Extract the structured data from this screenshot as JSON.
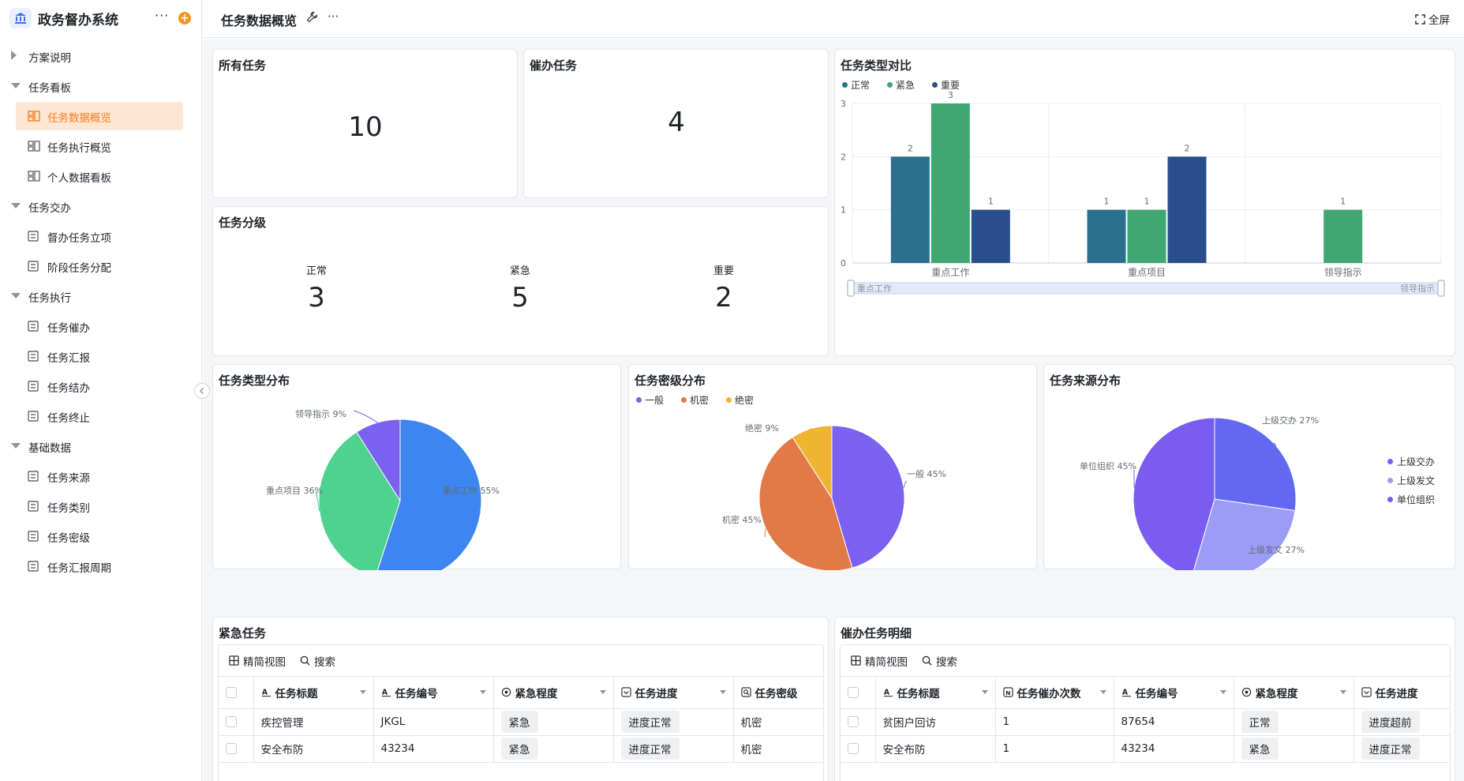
{
  "sidebar": {
    "app_title": "政务督办系统",
    "items": [
      {
        "label": "方案说明"
      },
      {
        "label": "任务看板"
      },
      {
        "label": "任务数据概览"
      },
      {
        "label": "任务执行概览"
      },
      {
        "label": "个人数据看板"
      },
      {
        "label": "任务交办"
      },
      {
        "label": "督办任务立项"
      },
      {
        "label": "阶段任务分配"
      },
      {
        "label": "任务执行"
      },
      {
        "label": "任务催办"
      },
      {
        "label": "任务汇报"
      },
      {
        "label": "任务结办"
      },
      {
        "label": "任务终止"
      },
      {
        "label": "基础数据"
      },
      {
        "label": "任务来源"
      },
      {
        "label": "任务类别"
      },
      {
        "label": "任务密级"
      },
      {
        "label": "任务汇报周期"
      }
    ]
  },
  "topbar": {
    "title": "任务数据概览",
    "fullscreen_label": "全屏"
  },
  "cards": {
    "all_tasks": {
      "title": "所有任务",
      "value": "10"
    },
    "urge_tasks": {
      "title": "催办任务",
      "value": "4"
    },
    "grading": {
      "title": "任务分级",
      "items": [
        {
          "label": "正常",
          "value": "3"
        },
        {
          "label": "紧急",
          "value": "5"
        },
        {
          "label": "重要",
          "value": "2"
        }
      ]
    }
  },
  "chart_data": [
    {
      "type": "bar",
      "title": "任务类型对比",
      "categories": [
        "重点工作",
        "重点项目",
        "领导指示"
      ],
      "series": [
        {
          "name": "正常",
          "color": "#2b6f8e",
          "values": [
            2,
            1,
            null
          ]
        },
        {
          "name": "紧急",
          "color": "#40a672",
          "values": [
            3,
            1,
            1
          ]
        },
        {
          "name": "重要",
          "color": "#2a4e8c",
          "values": [
            1,
            2,
            null
          ]
        }
      ],
      "yticks": [
        "0",
        "1",
        "2",
        "3"
      ],
      "ylim": [
        0,
        3
      ],
      "zoom_start_label": "重点工作",
      "zoom_end_label": "领导指示",
      "legend": "top-left"
    },
    {
      "type": "pie",
      "title": "任务类型分布",
      "slices": [
        {
          "label": "重点工作 55%",
          "value": 55,
          "color": "#3d86f2"
        },
        {
          "label": "重点项目 36%",
          "value": 36,
          "color": "#4fd18f"
        },
        {
          "label": "领导指示 9%",
          "value": 9,
          "color": "#7b61f0"
        }
      ]
    },
    {
      "type": "pie",
      "title": "任务密级分布",
      "legend_items": [
        {
          "name": "一般",
          "color": "#7b61f0"
        },
        {
          "name": "机密",
          "color": "#e27a48"
        },
        {
          "name": "绝密",
          "color": "#efb432"
        }
      ],
      "slices": [
        {
          "label": "一般 45%",
          "value": 45,
          "color": "#7b61f0"
        },
        {
          "label": "机密 45%",
          "value": 45,
          "color": "#e27a48"
        },
        {
          "label": "绝密 9%",
          "value": 9,
          "color": "#efb432"
        }
      ]
    },
    {
      "type": "pie",
      "title": "任务来源分布",
      "legend_items": [
        {
          "name": "上级交办",
          "color": "#6368f2"
        },
        {
          "name": "上级发文",
          "color": "#9b9cf6"
        },
        {
          "name": "单位组织",
          "color": "#7b5cf2"
        }
      ],
      "slices": [
        {
          "label": "上级交办 27%",
          "value": 27,
          "color": "#6368f2"
        },
        {
          "label": "上级发文 27%",
          "value": 27,
          "color": "#9b9cf6"
        },
        {
          "label": "单位组织 45%",
          "value": 45,
          "color": "#7b5cf2"
        }
      ]
    }
  ],
  "urgent_table": {
    "title": "紧急任务",
    "view_label": "精简视图",
    "search_label": "搜索",
    "headers": [
      "任务标题",
      "任务编号",
      "紧急程度",
      "任务进度",
      "任务密级"
    ],
    "rows": [
      [
        "疾控管理",
        "JKGL",
        "紧急",
        "进度正常",
        "机密"
      ],
      [
        "安全布防",
        "43234",
        "紧急",
        "进度正常",
        "机密"
      ]
    ]
  },
  "urge_table": {
    "title": "催办任务明细",
    "view_label": "精简视图",
    "search_label": "搜索",
    "headers": [
      "任务标题",
      "任务催办次数",
      "任务编号",
      "紧急程度",
      "任务进度"
    ],
    "rows": [
      [
        "贫困户回访",
        "1",
        "87654",
        "正常",
        "进度超前"
      ],
      [
        "安全布防",
        "1",
        "43234",
        "紧急",
        "进度正常"
      ]
    ]
  }
}
